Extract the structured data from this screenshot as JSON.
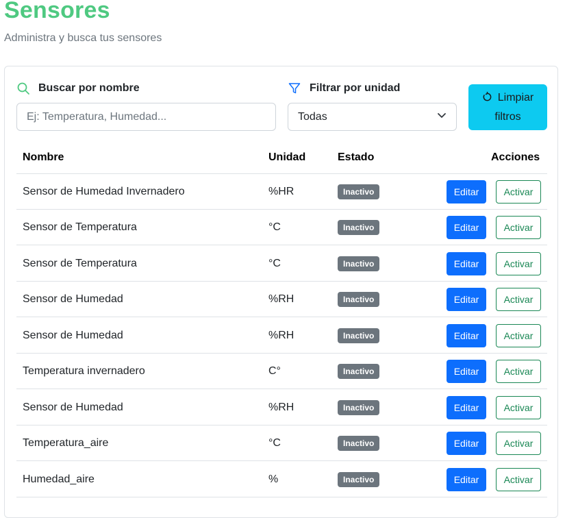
{
  "header": {
    "title": "Sensores",
    "subtitle": "Administra y busca tus sensores"
  },
  "filters": {
    "search_label": "Buscar por nombre",
    "search_placeholder": "Ej: Temperatura, Humedad...",
    "search_value": "",
    "unit_label": "Filtrar por unidad",
    "unit_selected": "Todas",
    "clear_label_line1": "Limpiar",
    "clear_label_line2": "filtros",
    "icons": {
      "search": "search-icon",
      "filter": "filter-icon",
      "clear": "refresh-icon",
      "select": "chevron-down-icon"
    },
    "accent_color": "#4fc981",
    "clear_color": "#0dcaf0"
  },
  "table": {
    "columns": [
      "Nombre",
      "Unidad",
      "Estado",
      "Acciones"
    ],
    "edit_label": "Editar",
    "activate_label": "Activar",
    "rows": [
      {
        "name": "Sensor de Humedad Invernadero",
        "unit": "%HR",
        "status": "Inactivo"
      },
      {
        "name": "Sensor de Temperatura",
        "unit": "°C",
        "status": "Inactivo"
      },
      {
        "name": "Sensor de Temperatura",
        "unit": "°C",
        "status": "Inactivo"
      },
      {
        "name": "Sensor de Humedad",
        "unit": "%RH",
        "status": "Inactivo"
      },
      {
        "name": "Sensor de Humedad",
        "unit": "%RH",
        "status": "Inactivo"
      },
      {
        "name": "Temperatura invernadero",
        "unit": "C°",
        "status": "Inactivo"
      },
      {
        "name": "Sensor de Humedad",
        "unit": "%RH",
        "status": "Inactivo"
      },
      {
        "name": "Temperatura_aire",
        "unit": "°C",
        "status": "Inactivo"
      },
      {
        "name": "Humedad_aire",
        "unit": "%",
        "status": "Inactivo"
      }
    ],
    "colors": {
      "edit": "#0d6efd",
      "activate": "#198754",
      "badge": "#6c757d"
    }
  }
}
